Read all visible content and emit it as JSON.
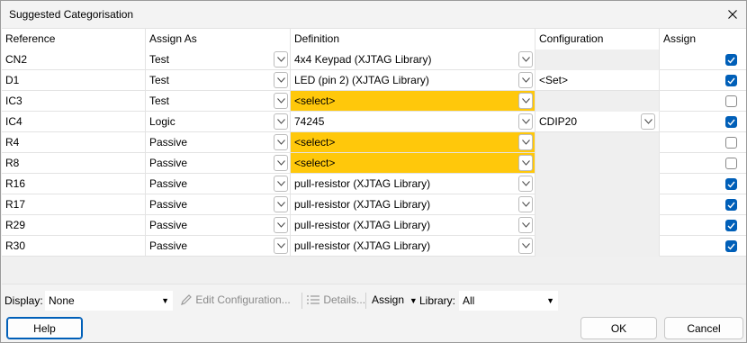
{
  "window": {
    "title": "Suggested Categorisation"
  },
  "columns": [
    "Reference",
    "Assign As",
    "Definition",
    "Configuration",
    "Assign"
  ],
  "rows": [
    {
      "reference": "CN2",
      "assign_as": "Test",
      "definition": "4x4 Keypad (XJTAG Library)",
      "def_state": "normal",
      "configuration": "",
      "config_state": "grey",
      "checked": true
    },
    {
      "reference": "D1",
      "assign_as": "Test",
      "definition": "LED (pin 2) (XJTAG Library)",
      "def_state": "normal",
      "configuration": "<Set>",
      "config_state": "text",
      "checked": true
    },
    {
      "reference": "IC3",
      "assign_as": "Test",
      "definition": "<select>",
      "def_state": "yellow",
      "configuration": "",
      "config_state": "grey",
      "checked": false
    },
    {
      "reference": "IC4",
      "assign_as": "Logic",
      "definition": "74245",
      "def_state": "normal",
      "configuration": "CDIP20",
      "config_state": "dropdown",
      "checked": true
    },
    {
      "reference": "R4",
      "assign_as": "Passive",
      "definition": "<select>",
      "def_state": "yellow",
      "configuration": "",
      "config_state": "grey",
      "checked": false
    },
    {
      "reference": "R8",
      "assign_as": "Passive",
      "definition": "<select>",
      "def_state": "yellow",
      "configuration": "",
      "config_state": "grey",
      "checked": false
    },
    {
      "reference": "R16",
      "assign_as": "Passive",
      "definition": "pull-resistor (XJTAG Library)",
      "def_state": "normal",
      "configuration": "",
      "config_state": "grey",
      "checked": true
    },
    {
      "reference": "R17",
      "assign_as": "Passive",
      "definition": "pull-resistor (XJTAG Library)",
      "def_state": "normal",
      "configuration": "",
      "config_state": "grey",
      "checked": true
    },
    {
      "reference": "R29",
      "assign_as": "Passive",
      "definition": "pull-resistor (XJTAG Library)",
      "def_state": "normal",
      "configuration": "",
      "config_state": "grey",
      "checked": true
    },
    {
      "reference": "R30",
      "assign_as": "Passive",
      "definition": "pull-resistor (XJTAG Library)",
      "def_state": "normal",
      "configuration": "",
      "config_state": "grey",
      "checked": true
    }
  ],
  "toolbar": {
    "display_label": "Display:",
    "display_value": "None",
    "edit_config": "Edit Configuration...",
    "details": "Details...",
    "assign": "Assign",
    "library_label": "Library:",
    "library_value": "All"
  },
  "buttons": {
    "help": "Help",
    "ok": "OK",
    "cancel": "Cancel"
  },
  "colors": {
    "accent": "#005fb8",
    "highlight": "#ffc80b"
  },
  "icons": {
    "close": "close-icon",
    "dropdown": "chevron-down-icon",
    "edit": "pencil-icon",
    "details": "list-icon"
  }
}
